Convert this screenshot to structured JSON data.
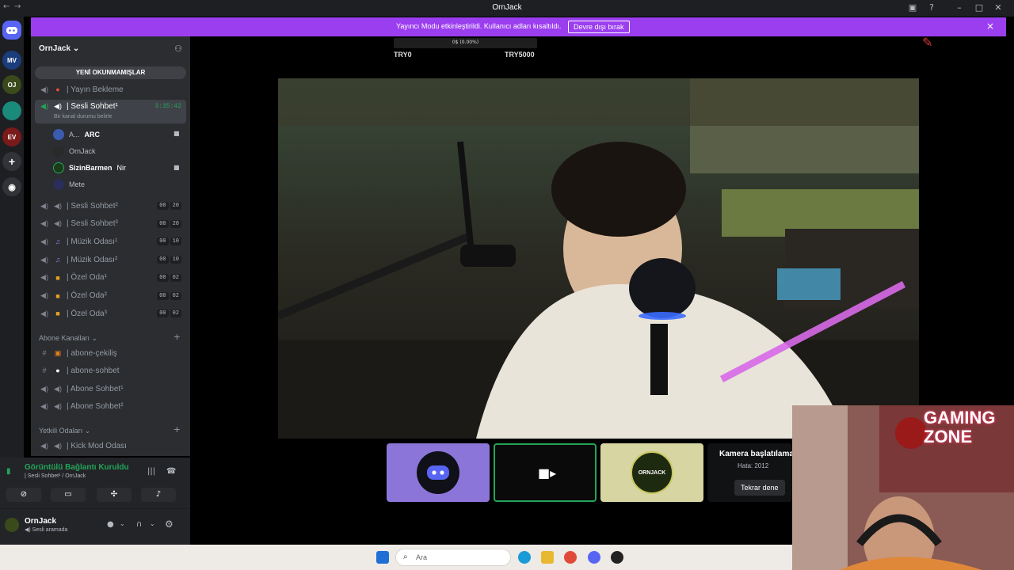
{
  "window": {
    "title": "OrnJack",
    "back_glyph": "←",
    "forward_glyph": "→"
  },
  "banner": {
    "message": "Yayıncı Modu etkinleştirildi. Kullanıcı adları kısaltıldı.",
    "button_label": "Devre dışı bırak",
    "close_glyph": "×"
  },
  "goal": {
    "progress_text": "0$ (0.00%)",
    "progress_fraction": 0.0,
    "left_label": "TRY0",
    "right_label": "TRY5000"
  },
  "servers": [
    {
      "label": "MV",
      "color": "#1a3d7c"
    },
    {
      "label": "OJ",
      "color": "#3a4a1a"
    },
    {
      "label": "",
      "color": "#1a8a7a"
    },
    {
      "label": "EV",
      "color": "#7a1a1a"
    }
  ],
  "server_name": "OrnJack",
  "unread_label": "YENİ OKUNMAMIŞLAR",
  "channels": {
    "yayin_bekleme": "| Yayın Bekleme",
    "sesli1": "| Sesli Sohbet¹",
    "sesli1_timer": "3:35:42",
    "sesli1_status": "Bir kanal durumu belirle",
    "members": [
      {
        "name": "A...",
        "tag": "ARC"
      },
      {
        "name": "OrnJack",
        "tag": ""
      },
      {
        "name": "SizinBarmen",
        "tag": "Nir"
      },
      {
        "name": "Mete",
        "tag": ""
      }
    ],
    "voice_list": [
      {
        "label": "| Sesli Sohbet²",
        "c1": "00",
        "c2": "20"
      },
      {
        "label": "| Sesli Sohbet³",
        "c1": "00",
        "c2": "20"
      },
      {
        "label": "| Müzik Odası¹",
        "c1": "00",
        "c2": "10"
      },
      {
        "label": "| Müzik Odası²",
        "c1": "00",
        "c2": "10"
      },
      {
        "label": "| Özel Oda¹",
        "c1": "00",
        "c2": "02"
      },
      {
        "label": "| Özel Oda²",
        "c1": "00",
        "c2": "02"
      },
      {
        "label": "| Özel Oda³",
        "c1": "00",
        "c2": "02"
      }
    ],
    "abone_category": "Abone Kanalları",
    "abone_cekilis": "| abone-çekiliş",
    "abone_sohbet": "| abone-sohbet",
    "abone_sesli1": "| Abone Sohbet¹",
    "abone_sesli2": "| Abone Sohbet²",
    "yetkili_category": "Yetkili Odaları",
    "kick_mod": "| Kick Mod Odası"
  },
  "voice_panel": {
    "status": "Görüntülü Bağlantı Kuruldu",
    "location": "| Sesli Sohbet¹ / OrnJack"
  },
  "user_panel": {
    "name": "OrnJack",
    "status": "Sesli aramada"
  },
  "tiles": {
    "camera_error_title": "Kamera başlatılama",
    "camera_error_code": "Hata: 2012",
    "retry_label": "Tekrar dene",
    "tile3_logo": "ORNJACK"
  },
  "webcam": {
    "sign_line1": "GAMING",
    "sign_line2": "ZONE"
  },
  "taskbar": {
    "search_placeholder": "Ara"
  }
}
